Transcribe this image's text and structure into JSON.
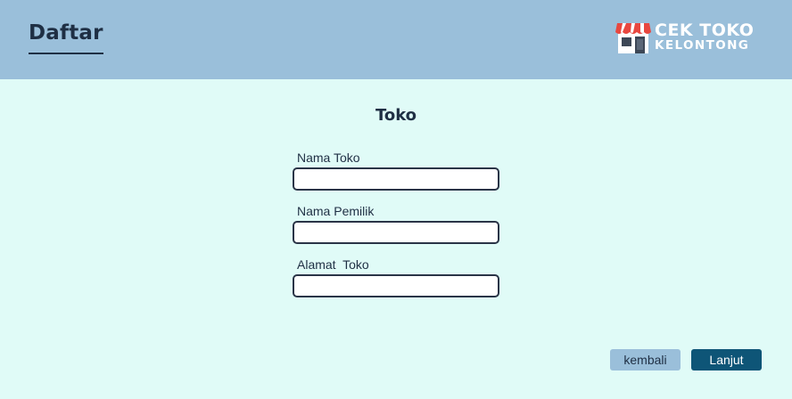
{
  "header": {
    "title": "Daftar",
    "logo": {
      "line1": "CEK TOKO",
      "line2": "KELONTONG",
      "icon": "store-icon",
      "colors": {
        "awning_red": "#e8473f",
        "awning_white": "#ffffff",
        "store_body": "#ffffff",
        "store_dark": "#3d4756"
      }
    }
  },
  "form": {
    "title": "Toko",
    "fields": [
      {
        "label": "Nama Toko",
        "value": "",
        "placeholder": ""
      },
      {
        "label": "Nama Pemilik",
        "value": "",
        "placeholder": ""
      },
      {
        "label": "Alamat  Toko",
        "value": "",
        "placeholder": ""
      }
    ]
  },
  "actions": {
    "back_label": "kembali",
    "next_label": "Lanjut"
  },
  "colors": {
    "header_bg": "#9abfda",
    "page_bg": "#e0fbf7",
    "text_dark": "#1f2f44",
    "primary_button": "#0e5577",
    "secondary_button": "#9abfda"
  }
}
